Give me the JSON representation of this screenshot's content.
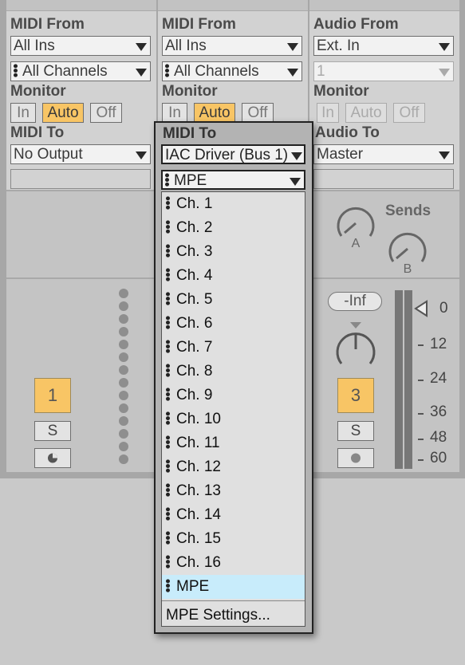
{
  "tracks": [
    {
      "input_label": "MIDI From",
      "input_source": "All Ins",
      "input_channel": "All Channels",
      "monitor_label": "Monitor",
      "monitor_options": [
        "In",
        "Auto",
        "Off"
      ],
      "monitor_selected": "Auto",
      "output_label": "MIDI To",
      "output_target": "No Output",
      "track_number": "1",
      "solo_label": "S"
    },
    {
      "input_label": "MIDI From",
      "input_source": "All Ins",
      "input_channel": "All Channels",
      "monitor_label": "Monitor",
      "monitor_options": [
        "In",
        "Auto",
        "Off"
      ],
      "monitor_selected": "Auto",
      "output_label": "MIDI To",
      "output_target": "IAC Driver (Bus 1)",
      "output_channel": "MPE"
    },
    {
      "input_label": "Audio From",
      "input_source": "Ext. In",
      "input_channel": "1",
      "monitor_label": "Monitor",
      "monitor_options": [
        "In",
        "Auto",
        "Off"
      ],
      "monitor_selected": "Auto",
      "output_label": "Audio To",
      "output_target": "Master",
      "sends_label": "Sends",
      "send_knobs": [
        "A",
        "B"
      ],
      "volume_readout": "-Inf",
      "meter_ticks": [
        "0",
        "12",
        "24",
        "36",
        "48",
        "60"
      ],
      "track_number": "3",
      "solo_label": "S"
    }
  ],
  "popup": {
    "header_label": "MIDI To",
    "target": "IAC Driver (Bus 1)",
    "channel": "MPE",
    "menu_items": [
      "Ch. 1",
      "Ch. 2",
      "Ch. 3",
      "Ch. 4",
      "Ch. 5",
      "Ch. 6",
      "Ch. 7",
      "Ch. 8",
      "Ch. 9",
      "Ch. 10",
      "Ch. 11",
      "Ch. 12",
      "Ch. 13",
      "Ch. 14",
      "Ch. 15",
      "Ch. 16",
      "MPE"
    ],
    "selected_item": "MPE",
    "settings_item": "MPE Settings..."
  },
  "colors": {
    "accent_orange": "#f8c565",
    "menu_selection": "#c8ecfb"
  }
}
